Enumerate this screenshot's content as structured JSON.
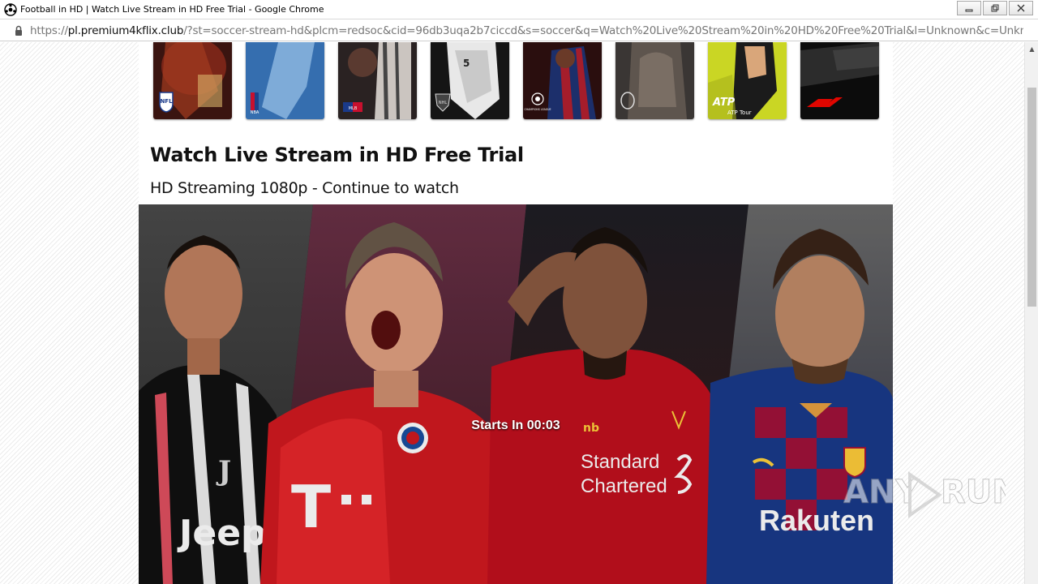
{
  "window": {
    "title": "Football in HD | Watch Live Stream in HD Free Trial - Google Chrome",
    "minimize": "▭",
    "restore": "❐",
    "close": "✕"
  },
  "address": {
    "scheme": "https://",
    "host": "pl.premium4kflix.club",
    "path": "/?st=soccer-stream-hd&plcm=redsoc&cid=96db3uqa2b7ciccd&s=soccer&q=Watch%20Live%20Stream%20in%20HD%20Free%20Trial&l=Unknown&c=Unknown&d=..."
  },
  "sports": [
    {
      "name": "NFL",
      "logo_text": "NFL",
      "bg": "#5a1a14"
    },
    {
      "name": "NBA",
      "logo_text": "NBA",
      "bg": "#1d4f88"
    },
    {
      "name": "MLB",
      "logo_text": "MLB",
      "bg": "#2b2b2b"
    },
    {
      "name": "NHL",
      "logo_text": "NHL",
      "bg": "#1a1a1a"
    },
    {
      "name": "Champions League",
      "logo_text": "CHAMPIONS LEAGUE",
      "bg": "#3a1010"
    },
    {
      "name": "Rugby",
      "logo_text": "",
      "bg": "#4a4440"
    },
    {
      "name": "ATP Tour",
      "logo_text": "ATP TOUR",
      "bg": "#c4d51c"
    },
    {
      "name": "Formula 1",
      "logo_text": "F1",
      "bg": "#0c0c0c"
    }
  ],
  "main": {
    "heading": "Watch Live Stream in HD Free Trial",
    "subheading": "HD Streaming 1080p - Continue to watch",
    "countdown_label": "Starts In",
    "countdown_value": "00:03"
  },
  "watermark": "ANY.RUN"
}
